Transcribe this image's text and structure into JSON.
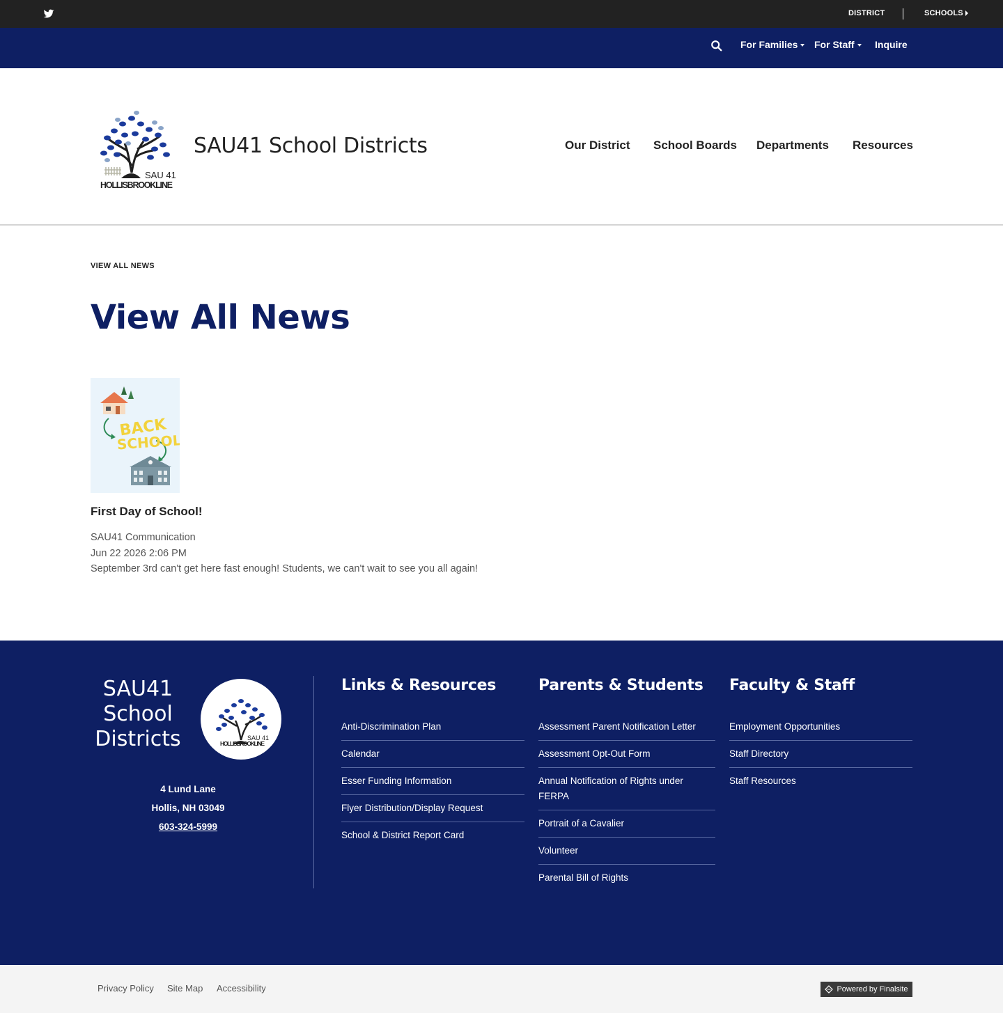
{
  "utility": {
    "district": "DISTRICT",
    "schools": "SCHOOLS"
  },
  "secondary_nav": {
    "items": [
      "For Families",
      "For Staff",
      "Inquire"
    ]
  },
  "header": {
    "logo_text_line1": "SAU 41",
    "logo_text_line2": "HOLLISBROOKLINE",
    "site_title": "SAU41 School Districts",
    "main_nav": [
      "Our District",
      "School Boards",
      "Departments",
      "Resources"
    ]
  },
  "main": {
    "breadcrumb": "VIEW ALL NEWS",
    "page_title": "View All News",
    "news": [
      {
        "thumb_text_line1": "BACK",
        "thumb_text_line2": "SCHOOL",
        "title": "First Day of School!",
        "author": "SAU41 Communication",
        "date": "Jun 22 2026 2:06 PM",
        "summary": "September 3rd can't get here fast enough! Students, we can't wait to see you all again!"
      }
    ]
  },
  "footer": {
    "brand_line1": "SAU41",
    "brand_line2": "School",
    "brand_line3": "Districts",
    "address_line1": "4 Lund Lane",
    "address_line2": "Hollis, NH  03049",
    "phone": "603-324-5999",
    "columns": [
      {
        "heading": "Links & Resources",
        "links": [
          "Anti-Discrimination Plan",
          "Calendar",
          "Esser Funding Information",
          "Flyer Distribution/Display Request",
          "School & District Report Card"
        ]
      },
      {
        "heading": "Parents & Students",
        "links": [
          "Assessment Parent Notification Letter",
          "Assessment Opt-Out Form",
          "Annual Notification of Rights under FERPA",
          "Portrait of a Cavalier",
          "Volunteer",
          "Parental Bill of Rights"
        ]
      },
      {
        "heading": "Faculty & Staff",
        "links": [
          "Employment Opportunities",
          "Staff Directory",
          "Staff Resources"
        ]
      }
    ]
  },
  "bottom": {
    "links": [
      "Privacy Policy",
      "Site Map",
      "Accessibility"
    ],
    "powered_by": "Powered by Finalsite"
  },
  "colors": {
    "navy": "#0e1f63",
    "utility_bar": "#222222",
    "bottom_bar": "#f4f4f4"
  }
}
